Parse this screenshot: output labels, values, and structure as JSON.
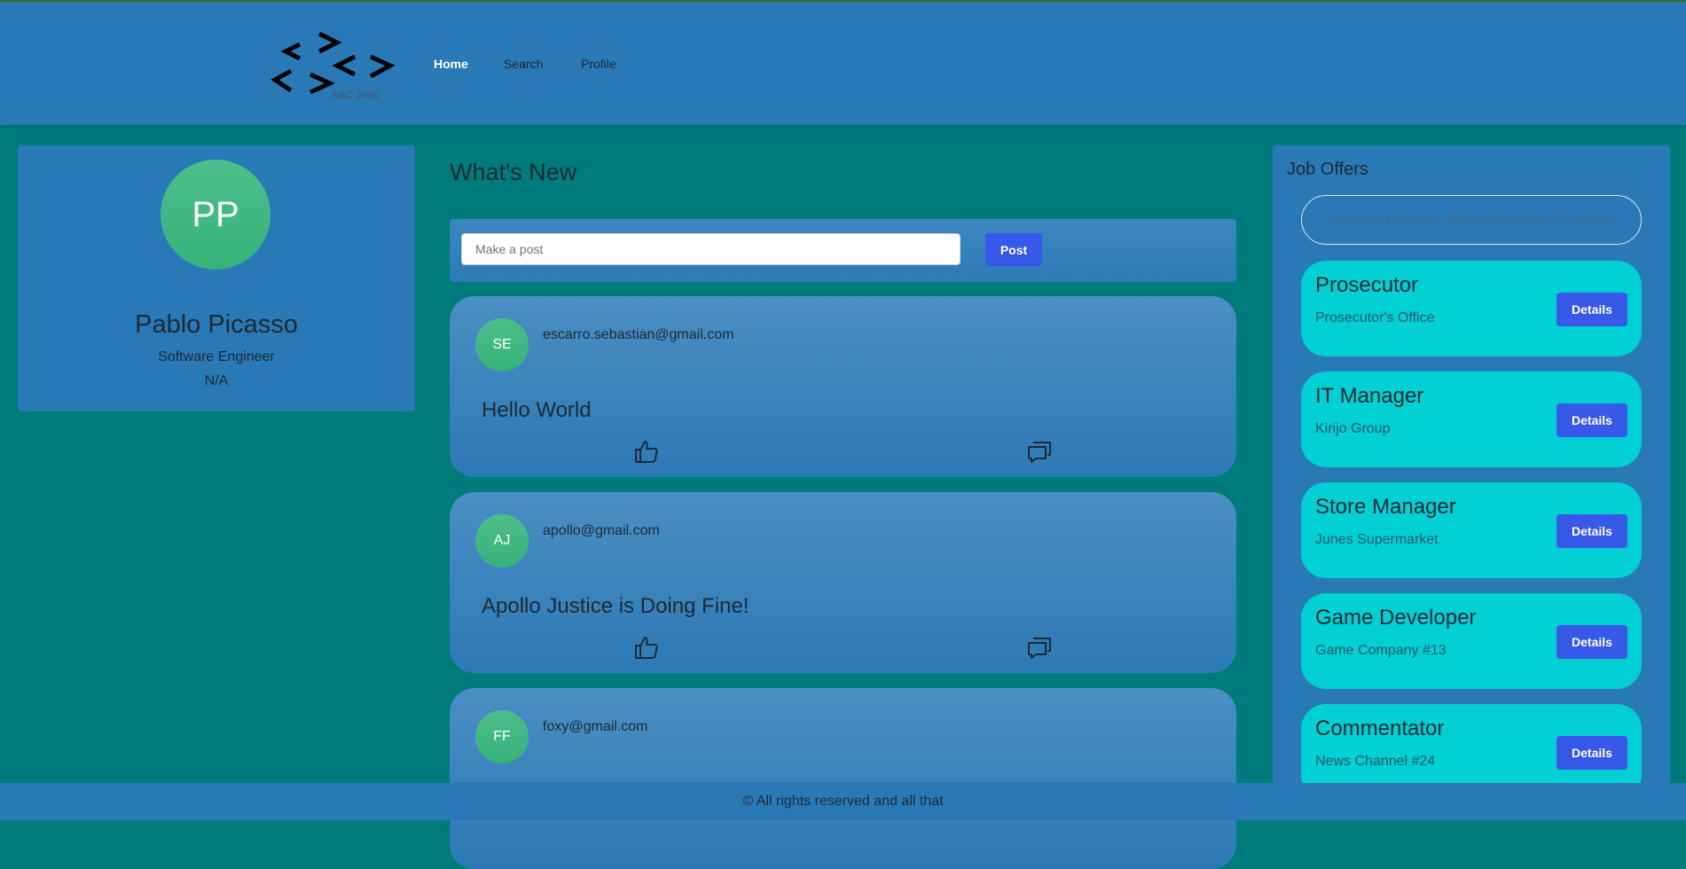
{
  "header": {
    "logo_text": "ABC Jobs",
    "nav": [
      {
        "label": "Home",
        "active": true
      },
      {
        "label": "Search",
        "active": false
      },
      {
        "label": "Profile",
        "active": false
      }
    ]
  },
  "profile": {
    "initials": "PP",
    "name": "Pablo Picasso",
    "title": "Software Engineer",
    "extra": "N/A"
  },
  "feed": {
    "heading": "What's New",
    "composer_placeholder": "Make a post",
    "post_button": "Post",
    "posts": [
      {
        "initials": "SE",
        "email": "escarro.sebastian@gmail.com",
        "body": "Hello World"
      },
      {
        "initials": "AJ",
        "email": "apollo@gmail.com",
        "body": "Apollo Justice is Doing Fine!"
      },
      {
        "initials": "FF",
        "email": "foxy@gmail.com",
        "body": ""
      }
    ]
  },
  "jobs": {
    "heading": "Job Offers",
    "status": "Systems Manager application status: Pending",
    "details_label": "Details",
    "offers": [
      {
        "title": "Prosecutor",
        "company": "Prosecutor's Office"
      },
      {
        "title": "IT Manager",
        "company": "Kirijo Group"
      },
      {
        "title": "Store Manager",
        "company": "Junes Supermarket"
      },
      {
        "title": "Game Developer",
        "company": "Game Company #13"
      },
      {
        "title": "Commentator",
        "company": "News Channel #24"
      }
    ]
  },
  "footer": {
    "text": "© All rights reserved and all that"
  },
  "colors": {
    "page_bg": "#007b7b",
    "panel_bg": "#2979b7",
    "job_card_bg": "#00cfd3",
    "button": "#3758e8",
    "avatar": "#3fb983"
  }
}
